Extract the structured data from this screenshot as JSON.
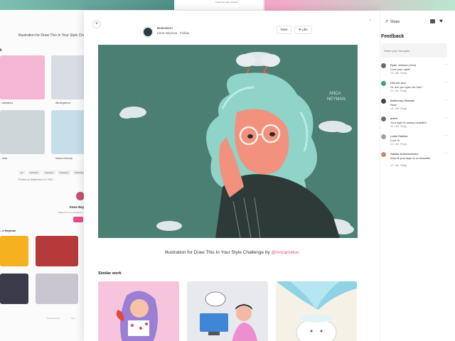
{
  "background_page": {
    "title": "Illustration for Draw This In Your Style Challenge",
    "side_mark": "k",
    "captions": [
      "...ustrations",
      "Ilka Angelova",
      "...iorks",
      "Sasha Chernyh"
    ],
    "tags": [
      "art",
      "character",
      "branding",
      "character",
      "illustration"
    ],
    "posted": "Posted on September 19, 2022",
    "author_name": "Irene Ney...",
    "welcome": "Welcome to my design p...",
    "more_by": "...e Neyman",
    "footer_left": "Product Shop",
    "footer_right": "Sel...",
    "top_right_text": "I hear the main concept"
  },
  "main": {
    "close_icon": "×",
    "shot_label": "Brainstorm",
    "author": "Irene Neyman",
    "follow": "Follow",
    "save_label": "Save",
    "like_label": "Like",
    "caption_text": "Illustration for Draw This In Your Style Challenge by",
    "caption_handle": "@Ancarzelus",
    "similar_title": "Similar work"
  },
  "panel": {
    "share_label": "Share",
    "feedback_title": "Feedback",
    "thoughts_placeholder": "Share your thoughts",
    "comments": [
      {
        "name": "Ryan Johnson (You)",
        "text": "Love your style!",
        "likes": "10",
        "color": "#6b6b6b"
      },
      {
        "name": "Dhruvin and",
        "text": "Hi. Are you open for hire?",
        "likes": "10",
        "color": "#3aa37b"
      },
      {
        "name": "Bartlomiej Otlowski",
        "text": "Nice!",
        "likes": "10",
        "color": "#444444"
      },
      {
        "name": "aofhri",
        "text": "Your style is amazy beautiful",
        "likes": "10",
        "color": "#7a6a5a"
      },
      {
        "name": "Lukta Galkina",
        "text": "Love it!",
        "likes": "10",
        "color": "#a0a0a0"
      },
      {
        "name": "Natalia Kolesnichenko",
        "text": "Wow ♥ your style is so beautiful",
        "likes": "12",
        "color": "#c48a6a"
      }
    ],
    "like_word": "Like",
    "reply_word": "Reply"
  }
}
